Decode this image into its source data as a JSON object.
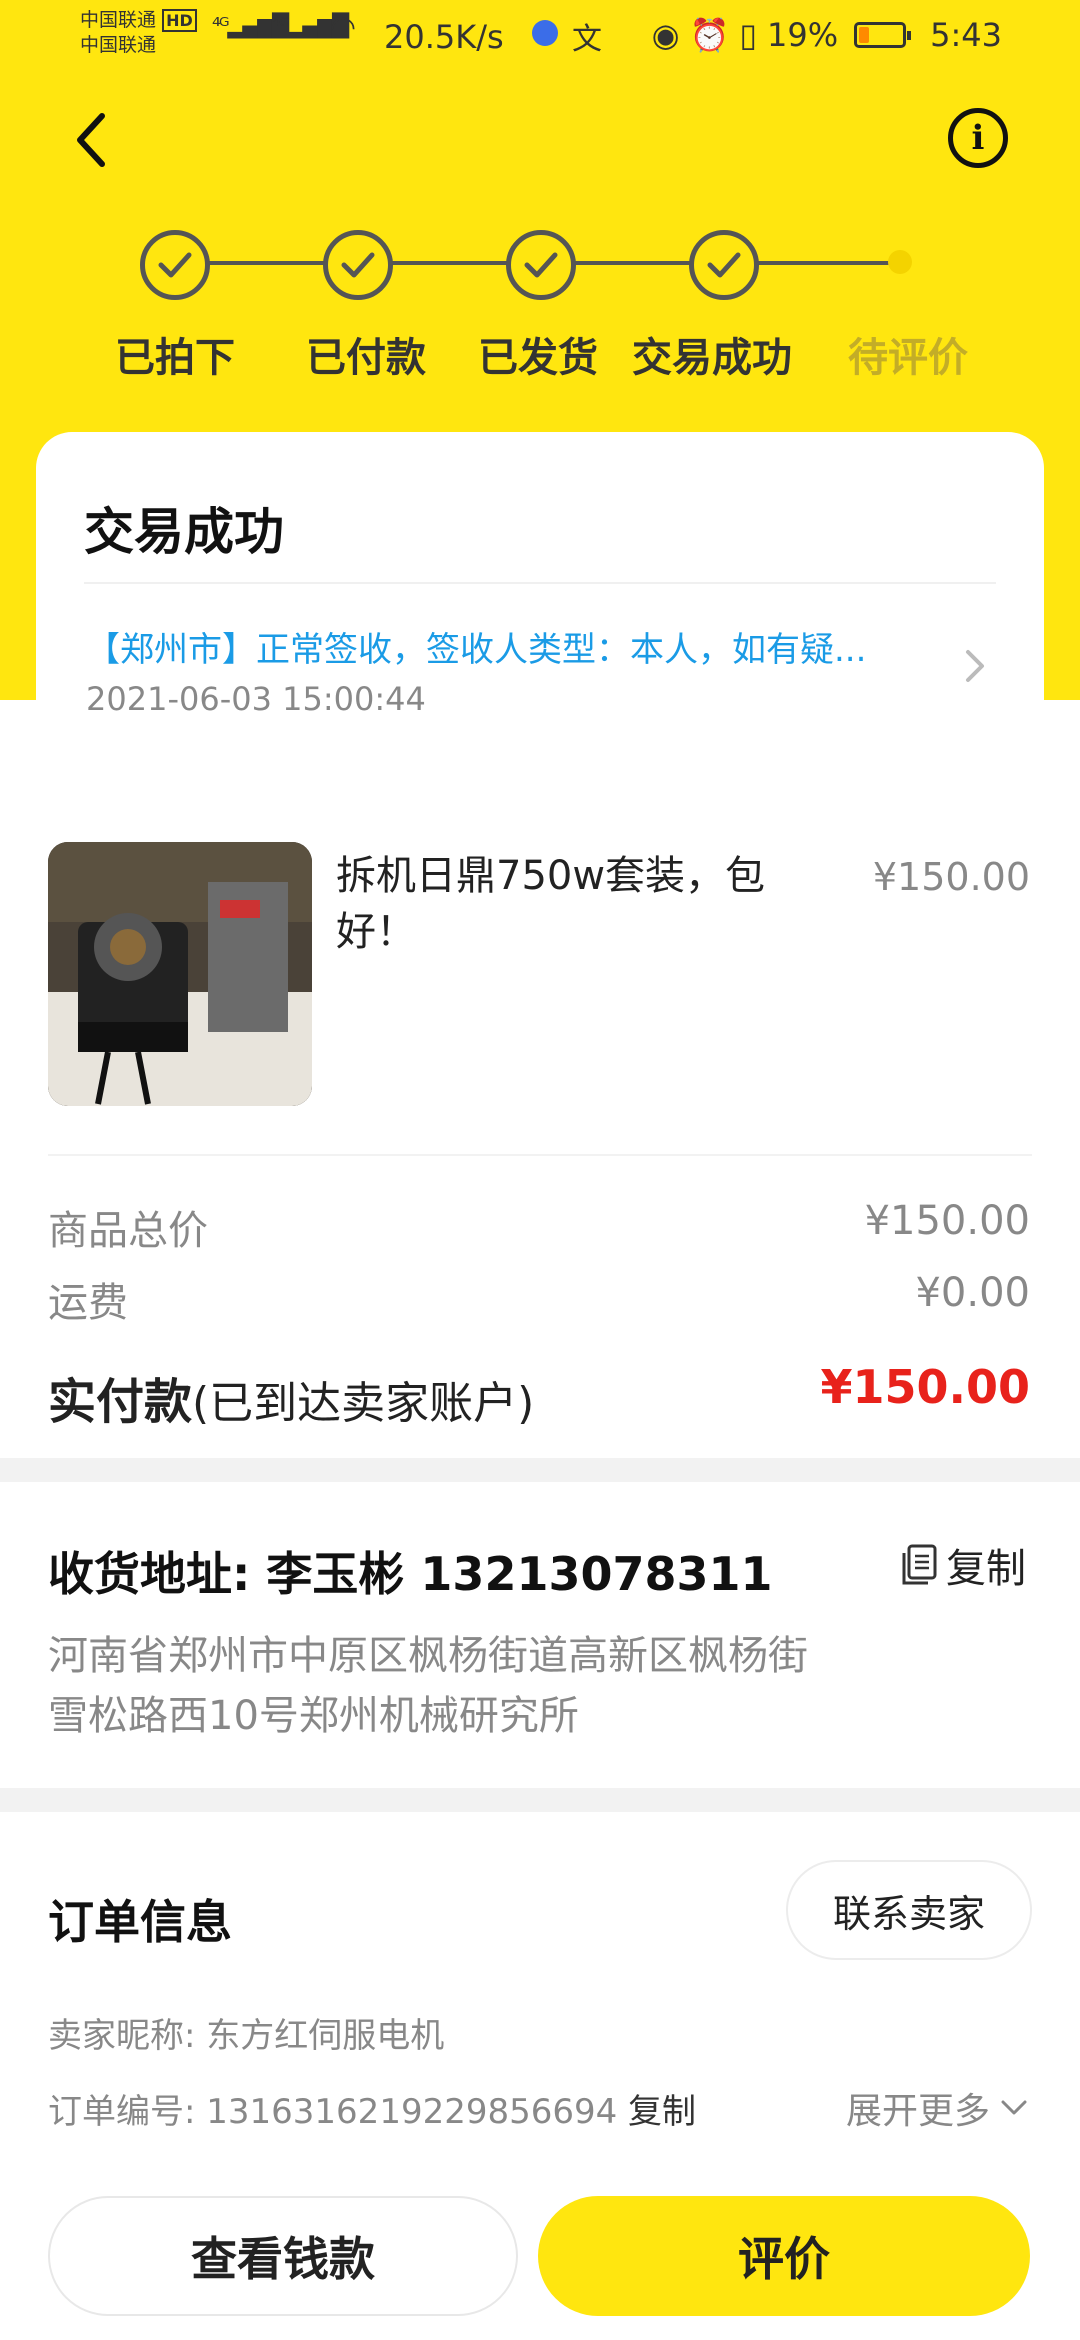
{
  "status_bar": {
    "carrier_1": "中国联通",
    "carrier_2": "中国联通",
    "hd": "HD",
    "net_speed": "20.5K/s",
    "battery": "19%",
    "time": "5:43"
  },
  "steps": [
    {
      "label": "已拍下",
      "done": true
    },
    {
      "label": "已付款",
      "done": true
    },
    {
      "label": "已发货",
      "done": true
    },
    {
      "label": "交易成功",
      "done": true
    },
    {
      "label": "待评价",
      "done": false
    }
  ],
  "status_card": {
    "title": "交易成功",
    "logistics": "【郑州市】正常签收，签收人类型：本人，如有疑...",
    "time": "2021-06-03 15:00:44"
  },
  "product": {
    "title": "拆机日鼎750w套装，包好！",
    "price": "¥150.00"
  },
  "summary": {
    "goods_label": "商品总价",
    "goods_value": "¥150.00",
    "shipping_label": "运费",
    "shipping_value": "¥0.00",
    "paid_label_bold": "实付款",
    "paid_label_note": "(已到达卖家账户)",
    "paid_value": "¥150.00"
  },
  "address": {
    "title": "收货地址:  李玉彬  13213078311",
    "copy": "复制",
    "line1": "河南省郑州市中原区枫杨街道高新区枫杨街",
    "line2": "雪松路西10号郑州机械研究所"
  },
  "order": {
    "title": "订单信息",
    "contact": "联系卖家",
    "seller": "卖家昵称: 东方红伺服电机",
    "number": "订单编号: 1316316219229856694",
    "copy": "复制",
    "expand": "展开更多"
  },
  "actions": {
    "view_money": "查看钱款",
    "rate": "评价"
  },
  "colors": {
    "brand_yellow": "#ffe60f",
    "price_red": "#e8221b",
    "link_blue": "#1a9be6"
  }
}
